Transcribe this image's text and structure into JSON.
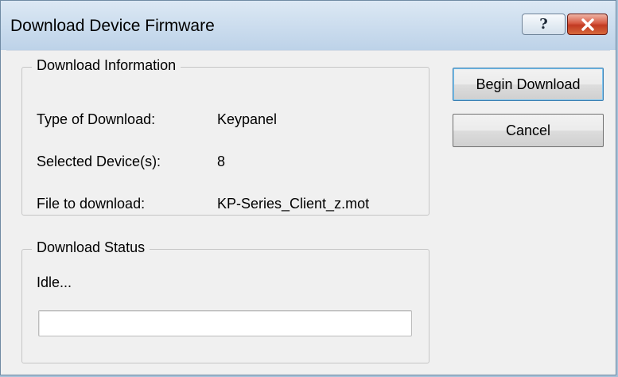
{
  "window": {
    "title": "Download Device Firmware",
    "help_glyph": "?",
    "close_icon": "close-icon"
  },
  "download_info": {
    "legend": "Download Information",
    "rows": [
      {
        "label": "Type of Download:",
        "value": "Keypanel"
      },
      {
        "label": "Selected Device(s):",
        "value": "8"
      },
      {
        "label": "File to download:",
        "value": "KP-Series_Client_z.mot"
      }
    ]
  },
  "download_status": {
    "legend": "Download Status",
    "status_text": "Idle...",
    "progress_fraction": 0
  },
  "buttons": {
    "begin_label": "Begin Download",
    "cancel_label": "Cancel"
  },
  "colors": {
    "close_button": "#c9452b",
    "default_button_border": "#3c7fb1"
  }
}
